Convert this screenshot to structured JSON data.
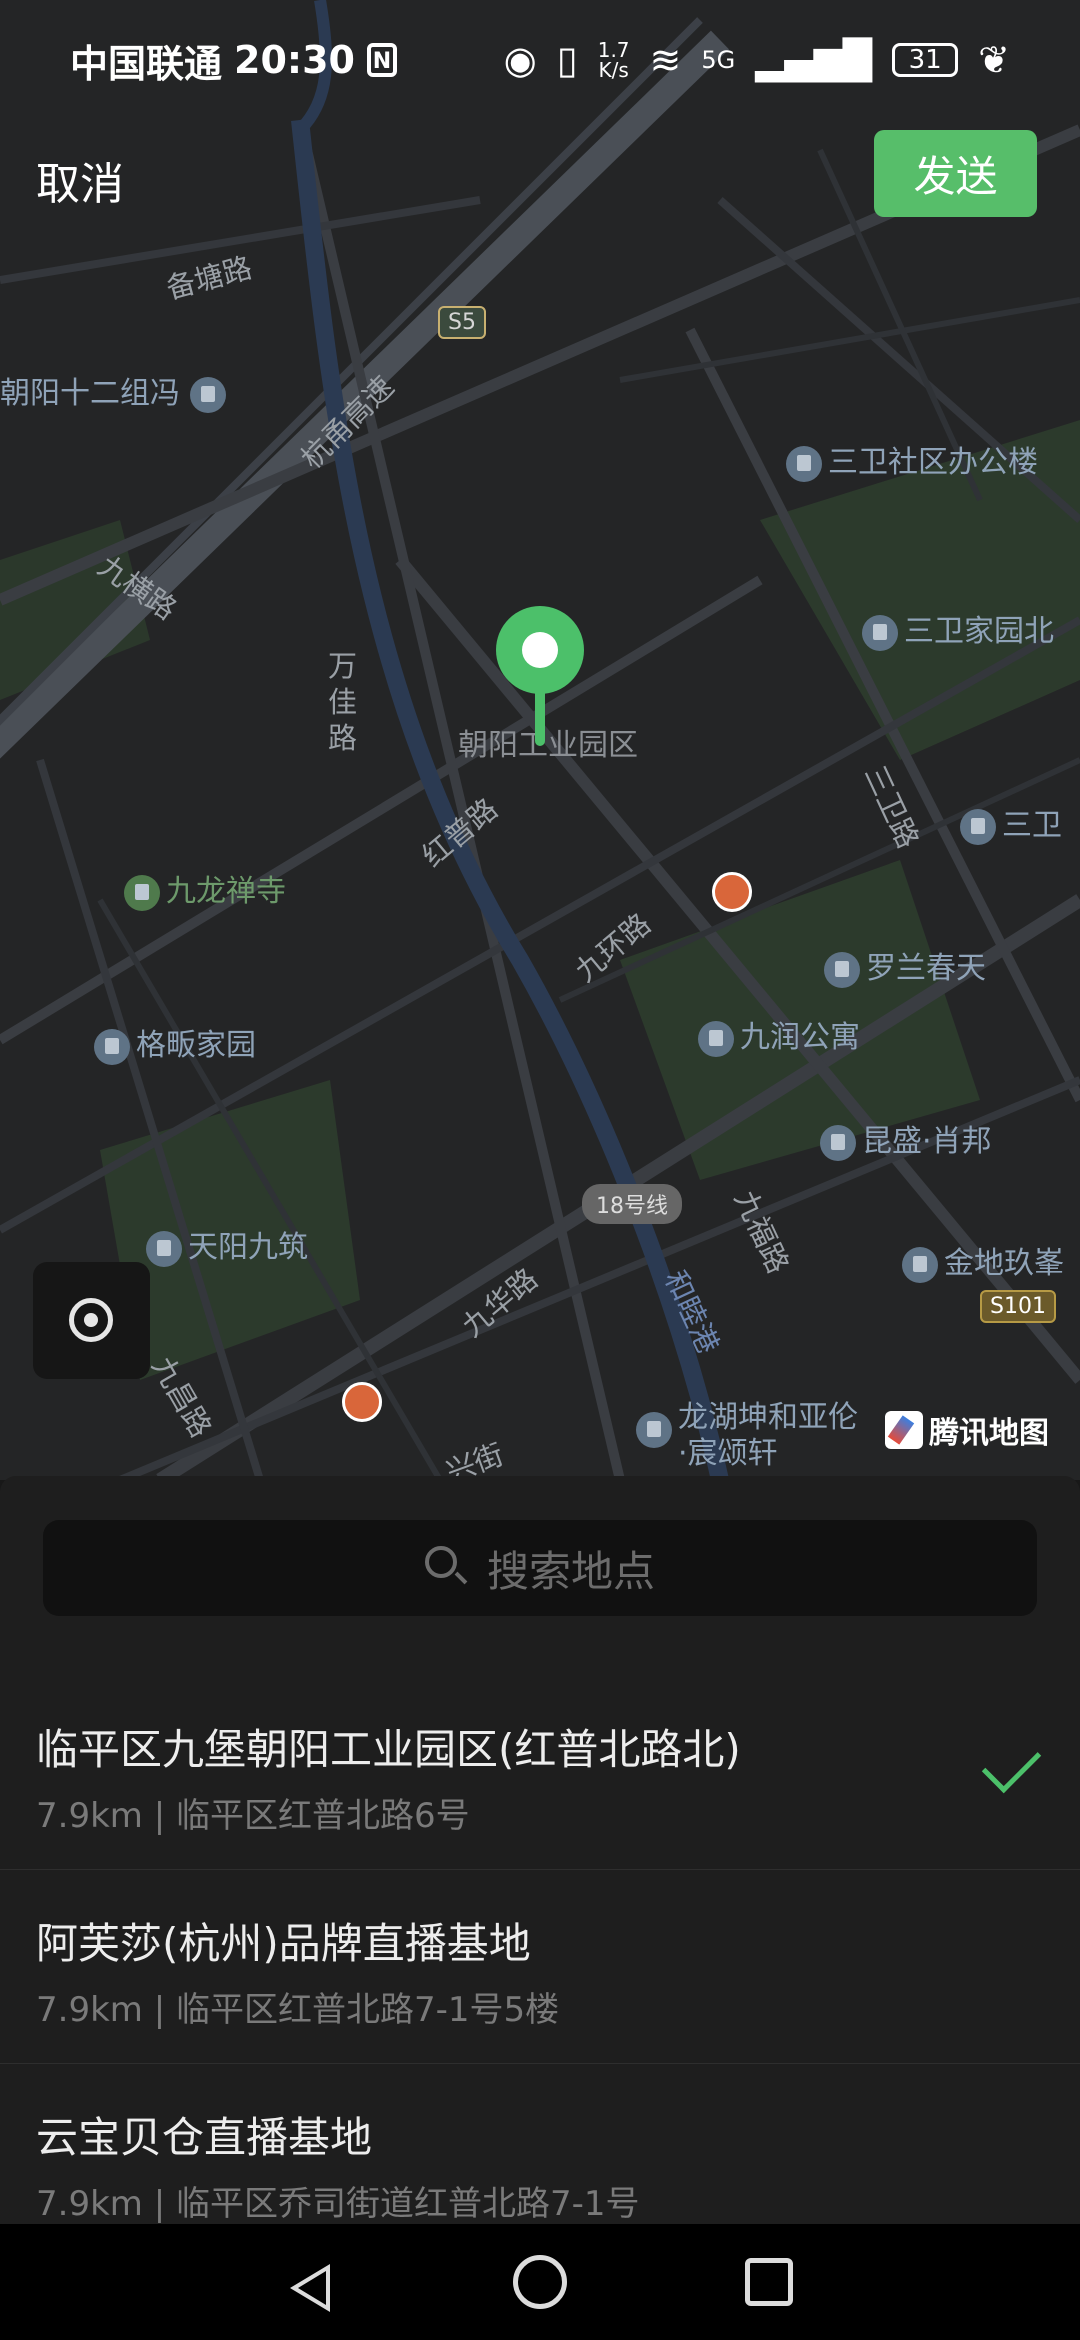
{
  "status_bar": {
    "carrier": "中国联通",
    "time": "20:30",
    "nfc": "N",
    "net_speed_value": "1.7",
    "net_speed_unit": "K/s",
    "network": "5G",
    "battery": "31"
  },
  "top_bar": {
    "cancel_label": "取消",
    "send_label": "发送"
  },
  "map": {
    "roads": {
      "beitang": "备塘路",
      "hangyong": "杭甬高速",
      "jiuheng": "九横路",
      "wanjia": "万佳路",
      "hongpu": "红普路",
      "jiuhuan": "九环路",
      "sanwei": "三卫路",
      "jiufu": "九福路",
      "jiuhua": "九华路",
      "jiuchang": "九昌路",
      "xing": "兴街",
      "hemu": "和睦港"
    },
    "badges": {
      "s5": "S5",
      "s101": "S101",
      "metro18": "18号线"
    },
    "pois": {
      "chaoyang12": "朝阳十二组冯",
      "sanwei_office": "三卫社区办公楼",
      "sanwei_home": "三卫家园北",
      "sanwei_partial": "三卫",
      "industrial_park": "朝阳工业园区",
      "jiulong_temple": "九龙禅寺",
      "luolan": "罗兰春天",
      "jiurun": "九润公寓",
      "gefan": "格畈家园",
      "kunsheng": "昆盛·肖邦",
      "tianyang": "天阳九筑",
      "jindi": "金地玖峯",
      "longhu_line1": "龙湖坤和亚伦",
      "longhu_line2": "·宸颂轩"
    },
    "provider_logo": "腾讯地图"
  },
  "search": {
    "placeholder": "搜索地点"
  },
  "locations": [
    {
      "name": "临平区九堡朝阳工业园区(红普北路北)",
      "address": "7.9km | 临平区红普北路6号",
      "selected": true
    },
    {
      "name": "阿芙莎(杭州)品牌直播基地",
      "address": "7.9km | 临平区红普北路7-1号5楼",
      "selected": false
    },
    {
      "name": "云宝贝仓直播基地",
      "address": "7.9km | 临平区乔司街道红普北路7-1号",
      "selected": false
    }
  ],
  "colors": {
    "accent": "#57be6a",
    "map_bg": "#242526",
    "sheet_bg": "#1e1e1e"
  }
}
